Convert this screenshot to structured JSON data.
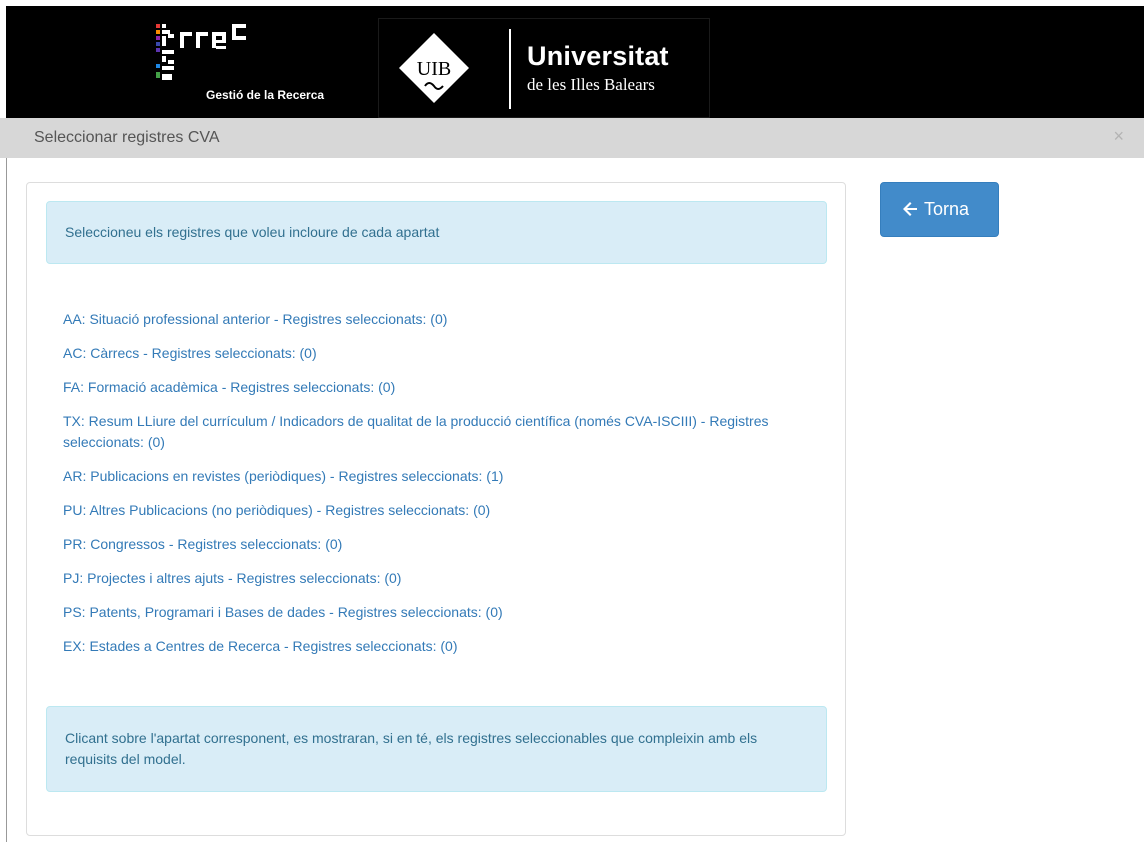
{
  "header": {
    "grec_logo_text": "Gestió de la Recerca",
    "university_name": "Universitat",
    "university_subtitle": "de les Illes Balears",
    "uib_mark": "UIB"
  },
  "dialog": {
    "title": "Seleccionar registres CVA",
    "close_label": "×"
  },
  "back_button": {
    "label": "Torna"
  },
  "intro_text": "Seleccioneu els registres que voleu incloure de cada apartat",
  "sections": [
    {
      "label": "AA: Situació professional anterior - Registres seleccionats: (0)"
    },
    {
      "label": "AC: Càrrecs - Registres seleccionats: (0)"
    },
    {
      "label": "FA: Formació acadèmica - Registres seleccionats: (0)"
    },
    {
      "label": "TX: Resum LLiure del currículum / Indicadors de qualitat de la producció científica (només CVA-ISCIII) - Registres seleccionats: (0)"
    },
    {
      "label": "AR: Publicacions en revistes (periòdiques) - Registres seleccionats: (1)"
    },
    {
      "label": "PU: Altres Publicacions (no periòdiques) - Registres seleccionats: (0)"
    },
    {
      "label": "PR: Congressos - Registres seleccionats: (0)"
    },
    {
      "label": "PJ: Projectes i altres ajuts - Registres seleccionats: (0)"
    },
    {
      "label": "PS: Patents, Programari i Bases de dades - Registres seleccionats: (0)"
    },
    {
      "label": "EX: Estades a Centres de Recerca - Registres seleccionats: (0)"
    }
  ],
  "footer_text": "Clicant sobre l'apartat corresponent, es mostraran, si en té, els registres seleccionables que compleixin amb els requisits del model.",
  "colors": {
    "link": "#337ab7",
    "info_bg": "#d9edf7",
    "info_text": "#31708f",
    "primary_button": "#428bca"
  }
}
